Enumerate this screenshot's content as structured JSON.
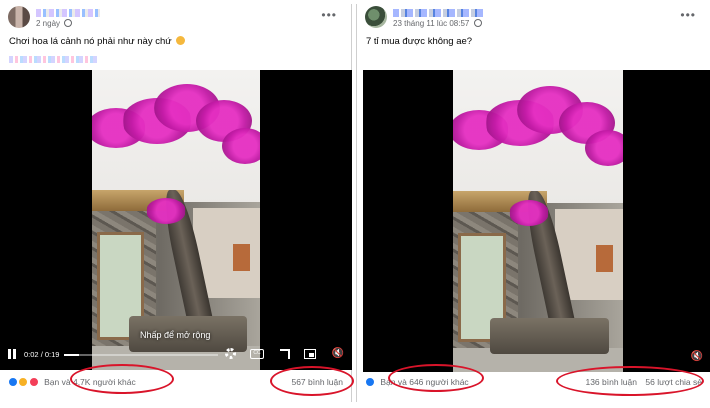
{
  "posts": [
    {
      "header": {
        "time": "2 ngày"
      },
      "caption": "Chơi hoa lá cảnh nó phải như này chứ",
      "video": {
        "tooltip": "Nhấp để mở rộng",
        "time_current": "0:02",
        "time_total": "0:19",
        "progress_fraction": 0.1,
        "cc_label": "CC"
      },
      "footer": {
        "reactions_prefix": "Bạn và",
        "reactions_count": "4,7K người khác",
        "comments": "567 bình luận"
      }
    },
    {
      "header": {
        "time": "23 tháng 11 lúc 08:57"
      },
      "caption": "7 tỉ mua được không ae?",
      "footer": {
        "reactions_prefix": "Bạn và",
        "reactions_count": "646 người khác",
        "comments": "136 bình luận",
        "shares": "56 lượt chia sẻ"
      }
    }
  ],
  "icons": {
    "more": "more-options-icon",
    "globe": "globe-icon",
    "like": "like-reaction-icon",
    "wow": "wow-reaction-icon",
    "love": "love-reaction-icon",
    "mute": "volume-mute-icon"
  },
  "colors": {
    "highlight": "#d9142a",
    "like_blue": "#1877f2",
    "bloom": "#c31aa6",
    "meta_gray": "#65676b"
  }
}
